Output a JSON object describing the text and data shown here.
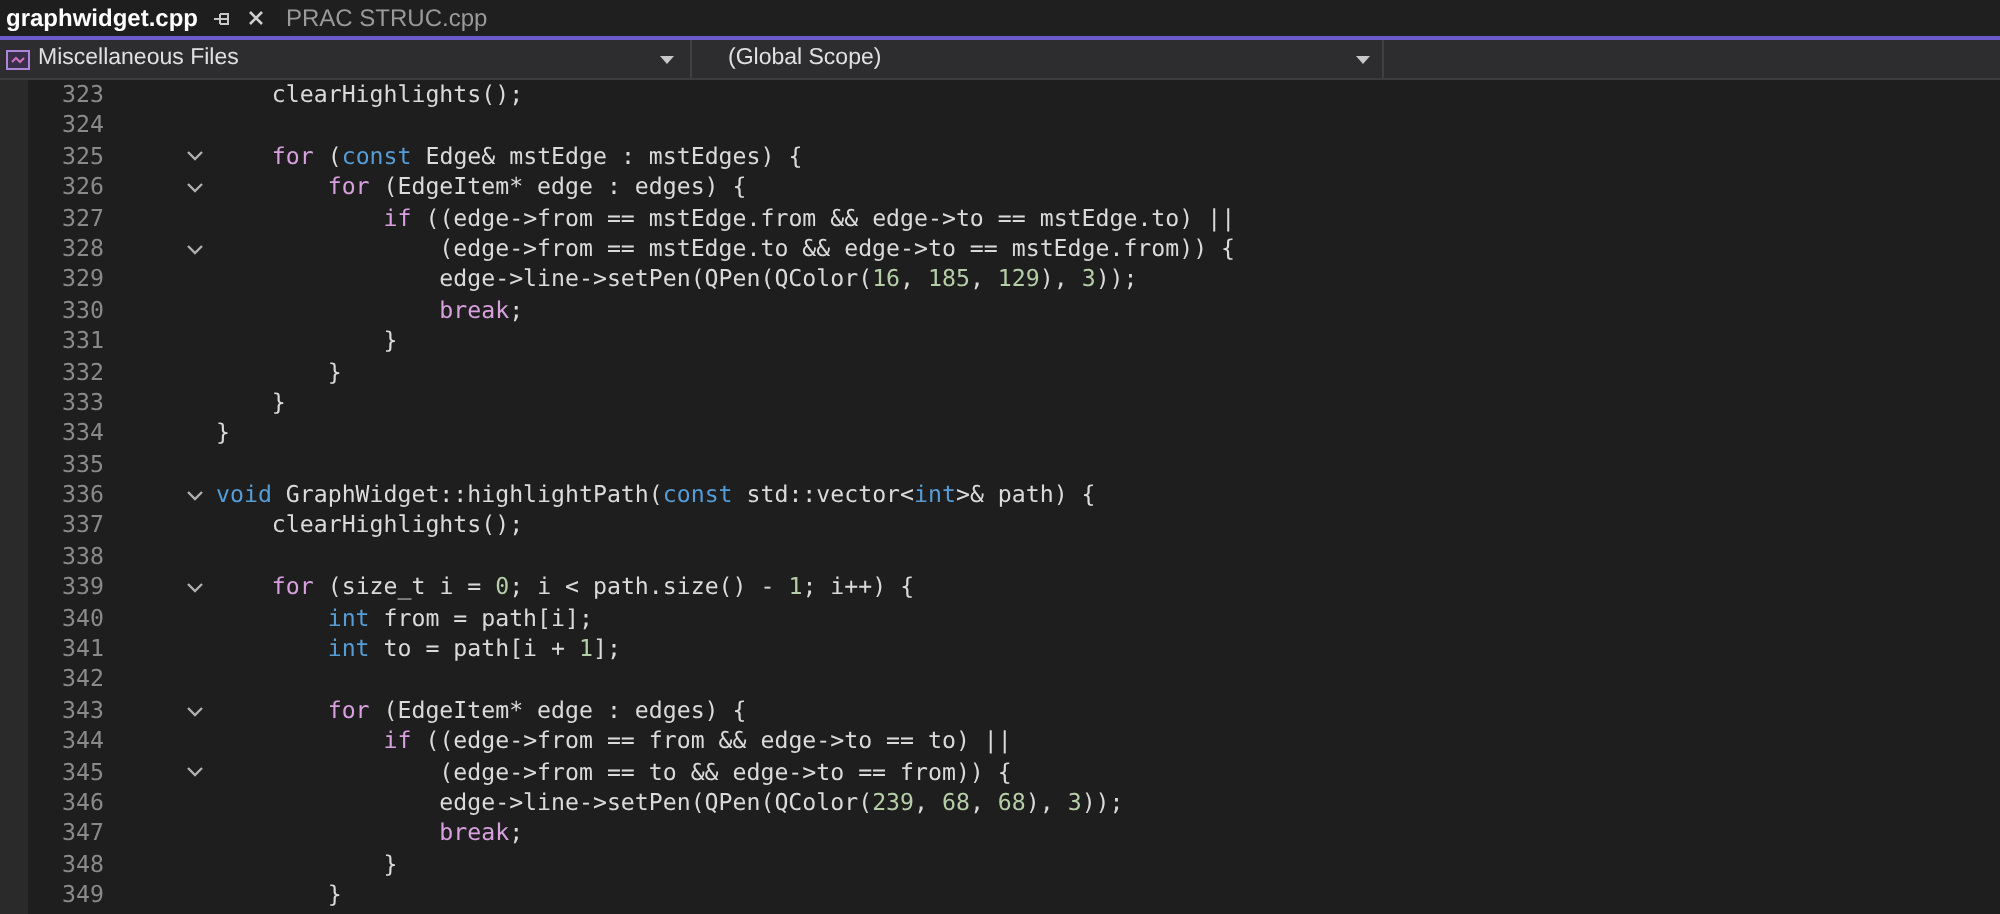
{
  "tabs": [
    {
      "label": "graphwidget.cpp",
      "selected": true,
      "pinned": true
    },
    {
      "label": "PRAC STRUC.cpp",
      "selected": false,
      "pinned": false
    }
  ],
  "navigation": {
    "project": "Miscellaneous Files",
    "scope": "(Global Scope)"
  },
  "lines": [
    {
      "number": "323",
      "fold": false,
      "tokens": [
        {
          "kind": "text",
          "text": "    clearHighlights();"
        }
      ]
    },
    {
      "number": "324",
      "fold": false
    },
    {
      "number": "325",
      "fold": true,
      "tokens": [
        {
          "kind": "control",
          "text": "    for"
        },
        {
          "kind": "text",
          "text": " ("
        },
        {
          "kind": "keyword",
          "text": "const"
        },
        {
          "kind": "text",
          "text": " Edge& mstEdge : mstEdges) {"
        }
      ]
    },
    {
      "number": "326",
      "fold": true,
      "tokens": [
        {
          "kind": "control",
          "text": "        for"
        },
        {
          "kind": "text",
          "text": " (EdgeItem* edge : edges) {"
        }
      ]
    },
    {
      "number": "327",
      "fold": false,
      "tokens": [
        {
          "kind": "control",
          "text": "            if"
        },
        {
          "kind": "text",
          "text": " ((edge->from == mstEdge.from && edge->to == mstEdge.to) ||"
        }
      ]
    },
    {
      "number": "328",
      "fold": true,
      "tokens": [
        {
          "kind": "text",
          "text": "                (edge->from == mstEdge.to && edge->to == mstEdge.from)) {"
        }
      ]
    },
    {
      "number": "329",
      "fold": false,
      "tokens": [
        {
          "kind": "text",
          "text": "                edge->line->setPen(QPen(QColor("
        },
        {
          "kind": "number",
          "text": "16"
        },
        {
          "kind": "text",
          "text": ", "
        },
        {
          "kind": "number",
          "text": "185"
        },
        {
          "kind": "text",
          "text": ", "
        },
        {
          "kind": "number",
          "text": "129"
        },
        {
          "kind": "text",
          "text": "), "
        },
        {
          "kind": "number",
          "text": "3"
        },
        {
          "kind": "text",
          "text": "));"
        }
      ]
    },
    {
      "number": "330",
      "fold": false,
      "tokens": [
        {
          "kind": "control",
          "text": "                break"
        },
        {
          "kind": "text",
          "text": ";"
        }
      ]
    },
    {
      "number": "331",
      "fold": false,
      "tokens": [
        {
          "kind": "text",
          "text": "            }"
        }
      ]
    },
    {
      "number": "332",
      "fold": false,
      "tokens": [
        {
          "kind": "text",
          "text": "        }"
        }
      ]
    },
    {
      "number": "333",
      "fold": false,
      "tokens": [
        {
          "kind": "text",
          "text": "    }"
        }
      ]
    },
    {
      "number": "334",
      "fold": false,
      "tokens": [
        {
          "kind": "text",
          "text": "}"
        }
      ]
    },
    {
      "number": "335",
      "fold": false
    },
    {
      "number": "336",
      "fold": true,
      "tokens": [
        {
          "kind": "keyword",
          "text": "void"
        },
        {
          "kind": "text",
          "text": " GraphWidget::highlightPath("
        },
        {
          "kind": "keyword",
          "text": "const"
        },
        {
          "kind": "text",
          "text": " std::vector<"
        },
        {
          "kind": "keyword",
          "text": "int"
        },
        {
          "kind": "text",
          "text": ">& path) {"
        }
      ]
    },
    {
      "number": "337",
      "fold": false,
      "tokens": [
        {
          "kind": "text",
          "text": "    clearHighlights();"
        }
      ]
    },
    {
      "number": "338",
      "fold": false
    },
    {
      "number": "339",
      "fold": true,
      "tokens": [
        {
          "kind": "control",
          "text": "    for"
        },
        {
          "kind": "text",
          "text": " (size_t i = "
        },
        {
          "kind": "number",
          "text": "0"
        },
        {
          "kind": "text",
          "text": "; i < path.size() - "
        },
        {
          "kind": "number",
          "text": "1"
        },
        {
          "kind": "text",
          "text": "; i++) {"
        }
      ]
    },
    {
      "number": "340",
      "fold": false,
      "tokens": [
        {
          "kind": "keyword",
          "text": "        int"
        },
        {
          "kind": "text",
          "text": " from = path[i];"
        }
      ]
    },
    {
      "number": "341",
      "fold": false,
      "tokens": [
        {
          "kind": "keyword",
          "text": "        int"
        },
        {
          "kind": "text",
          "text": " to = path[i + "
        },
        {
          "kind": "number",
          "text": "1"
        },
        {
          "kind": "text",
          "text": "];"
        }
      ]
    },
    {
      "number": "342",
      "fold": false
    },
    {
      "number": "343",
      "fold": true,
      "tokens": [
        {
          "kind": "control",
          "text": "        for"
        },
        {
          "kind": "text",
          "text": " (EdgeItem* edge : edges) {"
        }
      ]
    },
    {
      "number": "344",
      "fold": false,
      "tokens": [
        {
          "kind": "control",
          "text": "            if"
        },
        {
          "kind": "text",
          "text": " ((edge->from == from && edge->to == to) ||"
        }
      ]
    },
    {
      "number": "345",
      "fold": true,
      "tokens": [
        {
          "kind": "text",
          "text": "                (edge->from == to && edge->to == from)) {"
        }
      ]
    },
    {
      "number": "346",
      "fold": false,
      "tokens": [
        {
          "kind": "text",
          "text": "                edge->line->setPen(QPen(QColor("
        },
        {
          "kind": "number",
          "text": "239"
        },
        {
          "kind": "text",
          "text": ", "
        },
        {
          "kind": "number",
          "text": "68"
        },
        {
          "kind": "text",
          "text": ", "
        },
        {
          "kind": "number",
          "text": "68"
        },
        {
          "kind": "text",
          "text": "), "
        },
        {
          "kind": "number",
          "text": "3"
        },
        {
          "kind": "text",
          "text": "));"
        }
      ]
    },
    {
      "number": "347",
      "fold": false,
      "tokens": [
        {
          "kind": "control",
          "text": "                break"
        },
        {
          "kind": "text",
          "text": ";"
        }
      ]
    },
    {
      "number": "348",
      "fold": false,
      "tokens": [
        {
          "kind": "text",
          "text": "            }"
        }
      ]
    },
    {
      "number": "349",
      "fold": false,
      "tokens": [
        {
          "kind": "text",
          "text": "        }"
        }
      ]
    }
  ]
}
